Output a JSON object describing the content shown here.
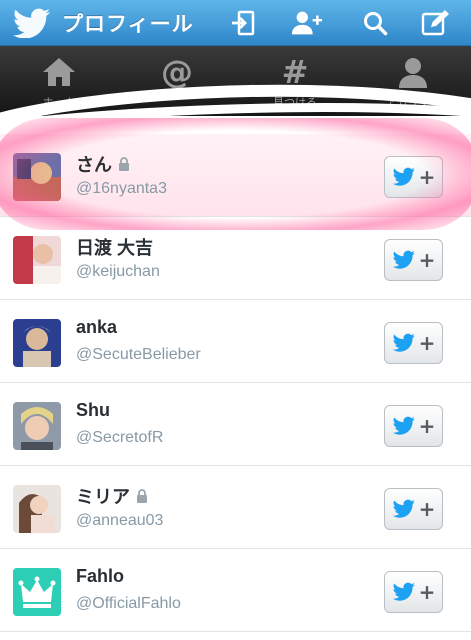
{
  "header": {
    "title": "プロフィール",
    "icons": [
      "twitter-bird-icon",
      "compose-sign-in-icon",
      "add-user-icon",
      "search-icon",
      "compose-icon"
    ]
  },
  "tabs": [
    {
      "label": "ホーム",
      "icon": "home-icon"
    },
    {
      "label": "@",
      "icon": "at-icon"
    },
    {
      "label": "見つける",
      "icon": "hashtag-icon"
    },
    {
      "label": "アカウント",
      "icon": "account-icon"
    }
  ],
  "users": [
    {
      "name": "さん",
      "handle": "@16nyanta3",
      "locked": true
    },
    {
      "name": "日渡 大吉",
      "handle": "@keijuchan",
      "locked": false
    },
    {
      "name": "anka",
      "handle": "@SecuteBelieber",
      "locked": false
    },
    {
      "name": "Shu",
      "handle": "@SecretofR",
      "locked": false
    },
    {
      "name": "ミリア",
      "handle": "@anneau03",
      "locked": true
    },
    {
      "name": "Fahlo",
      "handle": "@OfficialFahlo",
      "locked": false
    }
  ],
  "follow_button": {
    "plus": "+"
  },
  "colors": {
    "header_blue": "#2f86c9",
    "tabbar_dark": "#151515",
    "highlight_pink": "#ff5a96",
    "twitter_blue": "#1da1f2",
    "fahlo_teal": "#2ccfb5"
  }
}
